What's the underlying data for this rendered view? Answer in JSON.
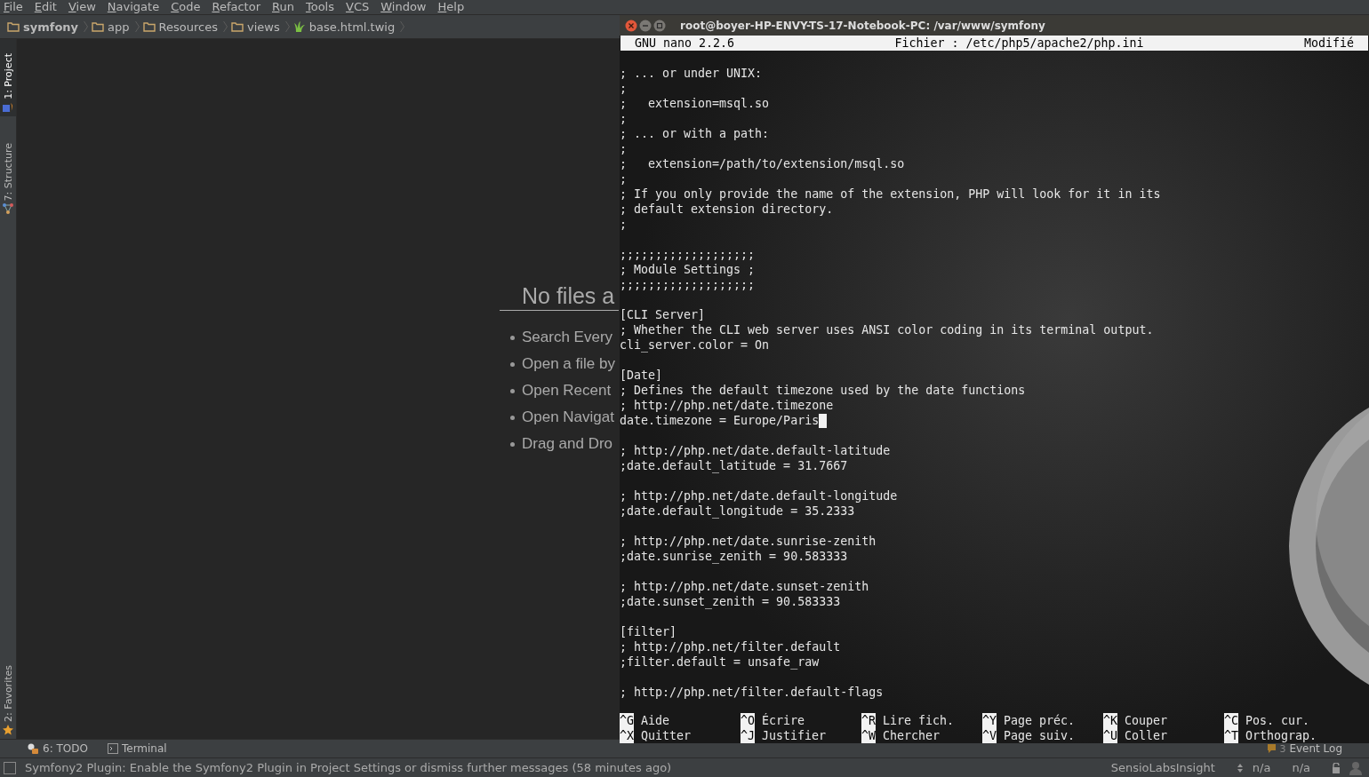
{
  "menu": [
    "File",
    "Edit",
    "View",
    "Navigate",
    "Code",
    "Refactor",
    "Run",
    "Tools",
    "VCS",
    "Window",
    "Help"
  ],
  "breadcrumbs": [
    {
      "label": "symfony",
      "kind": "folder",
      "bold": true
    },
    {
      "label": "app",
      "kind": "folder",
      "bold": false
    },
    {
      "label": "Resources",
      "kind": "folder",
      "bold": false
    },
    {
      "label": "views",
      "kind": "folder",
      "bold": false
    },
    {
      "label": "base.html.twig",
      "kind": "twig",
      "bold": false
    }
  ],
  "side_tabs": [
    {
      "label": "1: Project",
      "kind": "project",
      "selected": true
    },
    {
      "label": "7: Structure",
      "kind": "structure",
      "selected": false
    }
  ],
  "side_tabs_bottom": [
    {
      "label": "2: Favorites",
      "kind": "favorites",
      "selected": false
    }
  ],
  "welcome": {
    "title": "No files a",
    "items": [
      "Search Every",
      "Open a file by",
      "Open Recent",
      "Open Navigat",
      "Drag and Dro"
    ]
  },
  "terminal": {
    "title": "root@boyer-HP-ENVY-TS-17-Notebook-PC: /var/www/symfony",
    "nano": {
      "version": "GNU nano 2.2.6",
      "file": "Fichier : /etc/php5/apache2/php.ini",
      "status": "Modifié"
    },
    "blocks": [
      [
        {
          "text": "; ... or under UNIX:",
          "cursor": false
        },
        {
          "text": ";",
          "cursor": false
        },
        {
          "text": ";   extension=msql.so",
          "cursor": false
        },
        {
          "text": ";",
          "cursor": false
        },
        {
          "text": "; ... or with a path:",
          "cursor": false
        },
        {
          "text": ";",
          "cursor": false
        },
        {
          "text": ";   extension=/path/to/extension/msql.so",
          "cursor": false
        },
        {
          "text": ";",
          "cursor": false
        },
        {
          "text": "; If you only provide the name of the extension, PHP will look for it in its",
          "cursor": false
        },
        {
          "text": "; default extension directory.",
          "cursor": false
        },
        {
          "text": ";",
          "cursor": false
        }
      ],
      [
        {
          "text": ";;;;;;;;;;;;;;;;;;;",
          "cursor": false
        },
        {
          "text": "; Module Settings ;",
          "cursor": false
        },
        {
          "text": ";;;;;;;;;;;;;;;;;;;",
          "cursor": false
        }
      ],
      [
        {
          "text": "[CLI Server]",
          "cursor": false
        },
        {
          "text": "; Whether the CLI web server uses ANSI color coding in its terminal output.",
          "cursor": false
        },
        {
          "text": "cli_server.color = On",
          "cursor": false
        }
      ],
      [
        {
          "text": "[Date]",
          "cursor": false
        },
        {
          "text": "; Defines the default timezone used by the date functions",
          "cursor": false
        },
        {
          "text": "; http://php.net/date.timezone",
          "cursor": false
        },
        {
          "text": "date.timezone = Europe/Paris",
          "cursor": true
        }
      ],
      [
        {
          "text": "; http://php.net/date.default-latitude",
          "cursor": false
        },
        {
          "text": ";date.default_latitude = 31.7667",
          "cursor": false
        }
      ],
      [
        {
          "text": "; http://php.net/date.default-longitude",
          "cursor": false
        },
        {
          "text": ";date.default_longitude = 35.2333",
          "cursor": false
        }
      ],
      [
        {
          "text": "; http://php.net/date.sunrise-zenith",
          "cursor": false
        },
        {
          "text": ";date.sunrise_zenith = 90.583333",
          "cursor": false
        }
      ],
      [
        {
          "text": "; http://php.net/date.sunset-zenith",
          "cursor": false
        },
        {
          "text": ";date.sunset_zenith = 90.583333",
          "cursor": false
        }
      ],
      [
        {
          "text": "[filter]",
          "cursor": false
        },
        {
          "text": "; http://php.net/filter.default",
          "cursor": false
        },
        {
          "text": ";filter.default = unsafe_raw",
          "cursor": false
        }
      ],
      [
        {
          "text": "; http://php.net/filter.default-flags",
          "cursor": false
        }
      ]
    ],
    "shortcuts": [
      [
        {
          "key": "^G",
          "label": "Aide"
        },
        {
          "key": "^O",
          "label": "Écrire"
        },
        {
          "key": "^R",
          "label": "Lire fich."
        },
        {
          "key": "^Y",
          "label": "Page préc."
        },
        {
          "key": "^K",
          "label": "Couper"
        },
        {
          "key": "^C",
          "label": "Pos. cur."
        }
      ],
      [
        {
          "key": "^X",
          "label": "Quitter"
        },
        {
          "key": "^J",
          "label": "Justifier"
        },
        {
          "key": "^W",
          "label": "Chercher"
        },
        {
          "key": "^V",
          "label": "Page suiv."
        },
        {
          "key": "^U",
          "label": "Coller"
        },
        {
          "key": "^T",
          "label": "Orthograp."
        }
      ]
    ]
  },
  "tool_tabs": [
    {
      "label": "6: TODO",
      "kind": "todo"
    },
    {
      "label": "Terminal",
      "kind": "terminal"
    }
  ],
  "event_log": {
    "count": "3",
    "label": "Event Log"
  },
  "status_bar": {
    "message": "Symfony2 Plugin: Enable the Symfony2 Plugin in Project Settings or dismiss further messages (58 minutes ago)",
    "plugin": "SensioLabsInsight",
    "fields": [
      "n/a",
      "n/a"
    ]
  }
}
